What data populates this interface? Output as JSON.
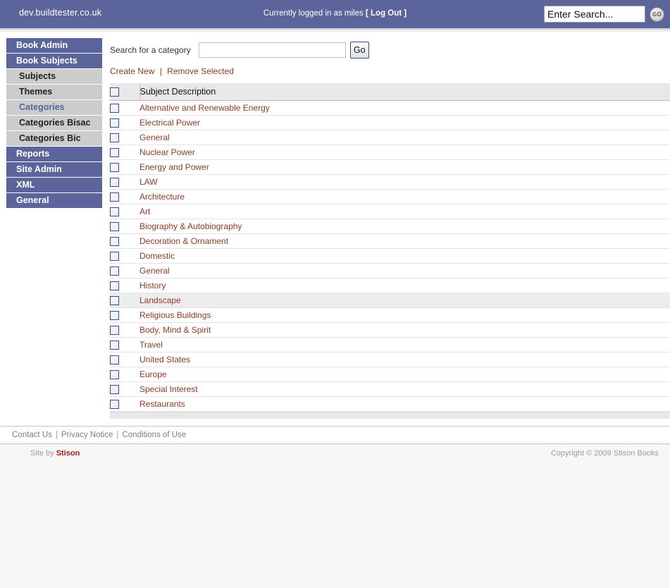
{
  "header": {
    "site_domain": "dev.buildtester.co.uk",
    "login_prefix": "Currently logged in as miles",
    "bracket_open": "[",
    "logout_label": "Log Out",
    "bracket_close": "]",
    "search_placeholder": "Enter Search...",
    "search_value": "",
    "go_label": "GO",
    "bar_color": "#5b659b"
  },
  "sidebar": {
    "items": [
      {
        "label": "Book Admin",
        "type": "top",
        "active": false
      },
      {
        "label": "Book Subjects",
        "type": "top",
        "active": false
      },
      {
        "label": "Subjects",
        "type": "sub",
        "active": false
      },
      {
        "label": "Themes",
        "type": "sub",
        "active": false
      },
      {
        "label": "Categories",
        "type": "sub",
        "active": true
      },
      {
        "label": "Categories Bisac",
        "type": "sub",
        "active": false
      },
      {
        "label": "Categories Bic",
        "type": "sub",
        "active": false
      },
      {
        "label": "Reports",
        "type": "top",
        "active": false
      },
      {
        "label": "Site Admin",
        "type": "top",
        "active": false
      },
      {
        "label": "XML",
        "type": "top",
        "active": false
      },
      {
        "label": "General",
        "type": "top",
        "active": false
      }
    ]
  },
  "main": {
    "category_search": {
      "label": "Search for a category",
      "value": "",
      "placeholder": "",
      "go_label": "Go"
    },
    "actions": {
      "create_new": "Create New",
      "separator": "|",
      "remove_selected": "Remove Selected"
    },
    "table": {
      "select_all_checked": false,
      "columns": [
        "",
        "Subject Description"
      ],
      "header_description": "Subject Description",
      "rows": [
        {
          "description": "Alternative and Renewable Energy",
          "checked": false,
          "hovered": false
        },
        {
          "description": "Electrical Power",
          "checked": false,
          "hovered": false
        },
        {
          "description": "General",
          "checked": false,
          "hovered": false
        },
        {
          "description": "Nuclear Power",
          "checked": false,
          "hovered": false
        },
        {
          "description": "Energy and Power",
          "checked": false,
          "hovered": false
        },
        {
          "description": "LAW",
          "checked": false,
          "hovered": false
        },
        {
          "description": "Architecture",
          "checked": false,
          "hovered": false
        },
        {
          "description": "Art",
          "checked": false,
          "hovered": false
        },
        {
          "description": "Biography & Autobiography",
          "checked": false,
          "hovered": false
        },
        {
          "description": "Decoration & Ornament",
          "checked": false,
          "hovered": false
        },
        {
          "description": "Domestic",
          "checked": false,
          "hovered": false
        },
        {
          "description": "General",
          "checked": false,
          "hovered": false
        },
        {
          "description": "History",
          "checked": false,
          "hovered": false
        },
        {
          "description": "Landscape",
          "checked": false,
          "hovered": true
        },
        {
          "description": "Religious Buildings",
          "checked": false,
          "hovered": false
        },
        {
          "description": "Body, Mind & Spirit",
          "checked": false,
          "hovered": false
        },
        {
          "description": "Travel",
          "checked": false,
          "hovered": false
        },
        {
          "description": "United States",
          "checked": false,
          "hovered": false
        },
        {
          "description": "Europe",
          "checked": false,
          "hovered": false
        },
        {
          "description": "Special Interest",
          "checked": false,
          "hovered": false
        },
        {
          "description": "Restaurants",
          "checked": false,
          "hovered": false
        }
      ]
    }
  },
  "footer": {
    "links": [
      "Contact Us",
      "Privacy Notice",
      "Conditions of Use"
    ],
    "separator": "|",
    "site_by_prefix": "Site by",
    "site_by_name": "Stison",
    "copyright": "Copyright © 2009 Stison Books"
  },
  "colors": {
    "brand_blue": "#5b659b",
    "link_maroon": "#8c3b23",
    "stison_red": "#a02020",
    "nav_sub_bg": "#cccccc",
    "table_header_bg": "#e8e8e8"
  }
}
